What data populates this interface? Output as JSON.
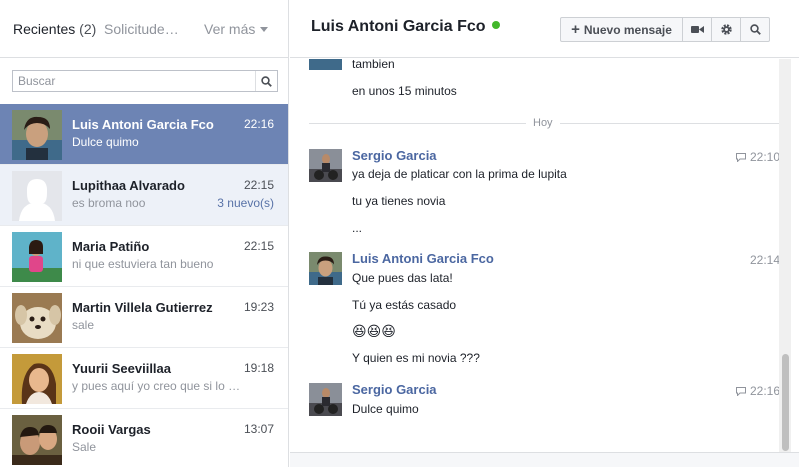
{
  "sidebar": {
    "tab_recent": "Recientes",
    "tab_recent_count": "(2)",
    "tab_requests": "Solicitude…",
    "see_more": "Ver más",
    "search_placeholder": "Buscar",
    "threads": [
      {
        "name": "Luis Antoni Garcia Fco",
        "time": "22:16",
        "snippet": "Dulce quimo",
        "unread": "",
        "state": "active"
      },
      {
        "name": "Lupithaa Alvarado",
        "time": "22:15",
        "snippet": "es broma noo",
        "unread": "3 nuevo(s)",
        "state": "unread"
      },
      {
        "name": "Maria Patiño",
        "time": "22:15",
        "snippet": "ni que estuviera tan bueno",
        "unread": "",
        "state": "read"
      },
      {
        "name": "Martin Villela Gutierrez",
        "time": "19:23",
        "snippet": "sale",
        "unread": "",
        "state": "read"
      },
      {
        "name": "Yuurii Seeviillaa",
        "time": "19:18",
        "snippet": "y pues aquí yo creo que si lo …",
        "unread": "",
        "state": "read"
      },
      {
        "name": "Rooii Vargas",
        "time": "13:07",
        "snippet": "Sale",
        "unread": "",
        "state": "read"
      }
    ]
  },
  "conversation": {
    "title": "Luis Antoni Garcia Fco",
    "status_color": "#42b72a",
    "toolbar": {
      "new_message": "Nuevo mensaje",
      "video_icon": "video-camera-icon",
      "settings_icon": "gear-icon",
      "search_icon": "search-icon"
    },
    "early_lines": [
      "tambien",
      "en unos 15 minutos"
    ],
    "divider_label": "Hoy",
    "groups": [
      {
        "sender": "Sergio Garcia",
        "time": "22:10",
        "lines": [
          "ya deja de platicar con la prima de lupita",
          "tu ya tienes novia",
          "..."
        ]
      },
      {
        "sender": "Luis Antoni Garcia Fco",
        "time": "22:14",
        "lines": [
          "Que pues das lata!",
          "Tú ya estás casado",
          "😆😆😆",
          "Y quien es mi novia ???"
        ]
      },
      {
        "sender": "Sergio Garcia",
        "time": "22:16",
        "lines": [
          "Dulce quimo"
        ]
      }
    ]
  },
  "colors": {
    "active_thread": "#6d84b4",
    "unread_thread": "#edf1f8",
    "sender_link": "#4b67a1",
    "unread_count": "#5872a7"
  }
}
